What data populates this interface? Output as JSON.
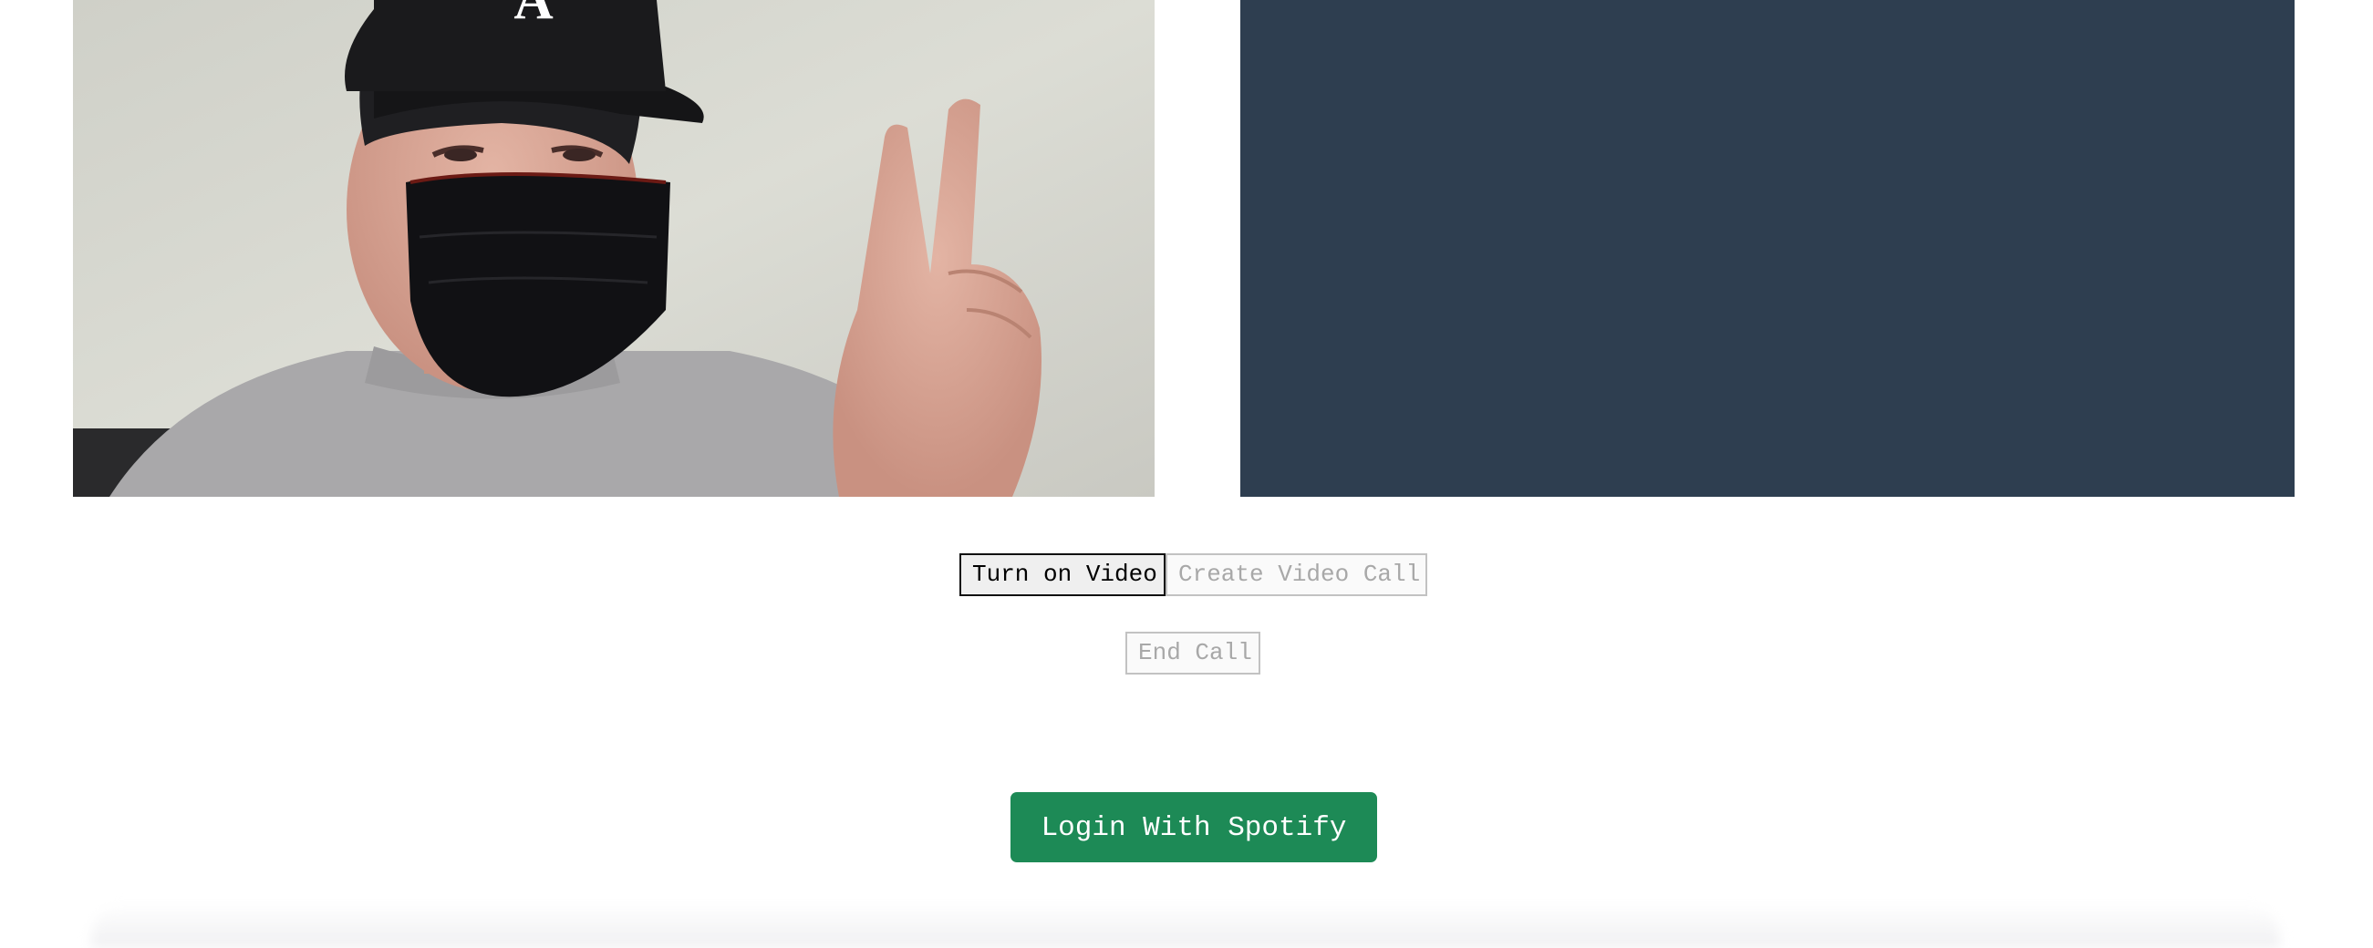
{
  "local_video": {
    "subject": "person-with-cap-and-mask"
  },
  "remote_video": {
    "background_color": "#2e3e50"
  },
  "controls": {
    "turn_on_video_label": "Turn on Video",
    "create_video_call_label": "Create Video Call",
    "end_call_label": "End Call"
  },
  "spotify": {
    "login_label": "Login With Spotify",
    "brand_color": "#1d8a56"
  }
}
